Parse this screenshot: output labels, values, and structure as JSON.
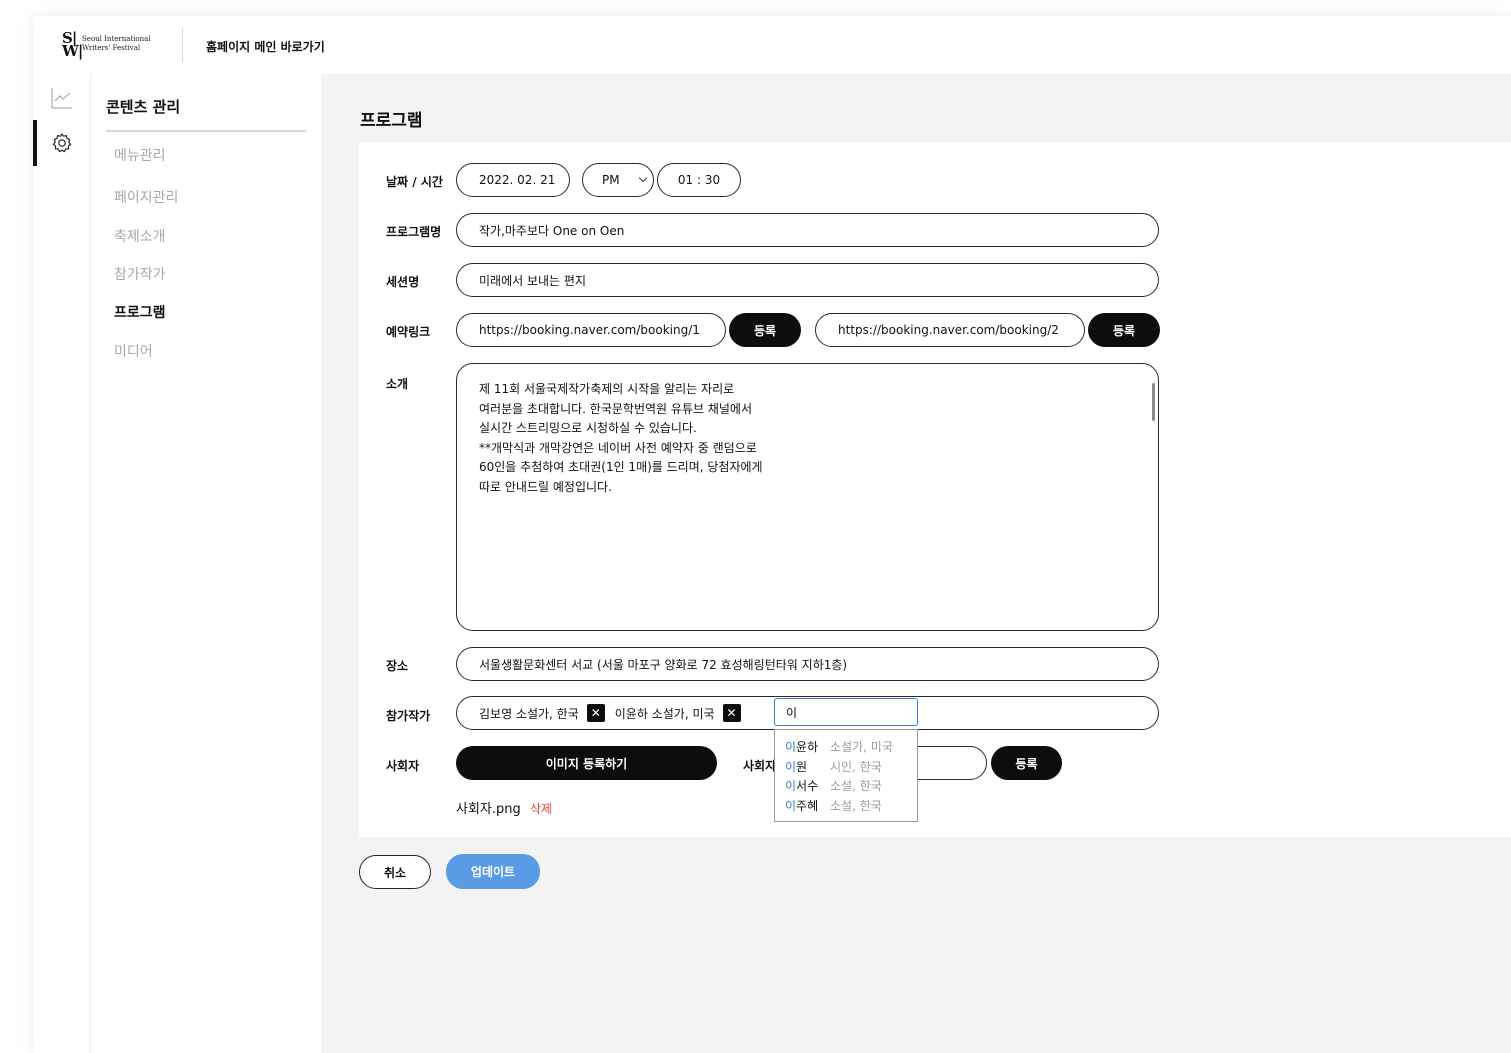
{
  "header": {
    "logo_mark": "SI\nWF",
    "logo_text": "Seoul International\nWriters' Festival",
    "home_link": "홈페이지 메인 바로가기"
  },
  "rail": {
    "icons": [
      "chart-icon",
      "gear-icon"
    ]
  },
  "sidebar": {
    "title": "콘텐츠 관리",
    "items": [
      {
        "label": "메뉴관리"
      },
      {
        "label": "페이지관리"
      },
      {
        "label": "축제소개"
      },
      {
        "label": "참가작가"
      },
      {
        "label": "프로그램"
      },
      {
        "label": "미디어"
      }
    ],
    "active": "프로그램"
  },
  "page": {
    "title": "프로그램"
  },
  "form": {
    "datetime": {
      "label": "날짜 / 시간",
      "date": "2022. 02. 21",
      "ampm": "PM",
      "time": "01 : 30"
    },
    "program_name": {
      "label": "프로그램명",
      "value": "작가,마주보다 One on Oen"
    },
    "session_name": {
      "label": "세션명",
      "value": "미래에서 보내는 편지"
    },
    "booking": {
      "label": "예약링크",
      "link1": "https://booking.naver.com/booking/1",
      "link2": "https://booking.naver.com/booking/2",
      "register_label": "등록"
    },
    "intro": {
      "label": "소개",
      "lines": [
        "제 11회 서울국제작가축제의 시작을 알리는 자리로",
        "여러분을 초대합니다. 한국문학번역원 유튜브 채널에서",
        "실시간 스트리밍으로 시청하실 수 있습니다.",
        "**개막식과 개막강연은 네이버 사전 예약자 중 랜덤으로",
        "60인을 추첨하여 초대권(1인 1매)를 드리며, 당첨자에게",
        "따로 안내드릴 예정입니다."
      ]
    },
    "venue": {
      "label": "장소",
      "value": "서울생활문화센터 서교 (서울 마포구 양화로 72 효성해링턴타워 지하1층)"
    },
    "authors": {
      "label": "참가작가",
      "tags": [
        "김보영 소설가, 한국",
        "이윤하 소설가, 미국"
      ],
      "input_value": "이",
      "suggestions": [
        {
          "name": "이윤하",
          "desc": "소설가, 미국"
        },
        {
          "name": "이원",
          "desc": "시인, 한국"
        },
        {
          "name": "이서수",
          "desc": "소설, 한국"
        },
        {
          "name": "이주혜",
          "desc": "소설, 한국"
        }
      ]
    },
    "host": {
      "label": "사회자",
      "image_button": "이미지 등록하기",
      "label2": "사회자",
      "register_label": "등록",
      "file_name": "사회자.png",
      "delete_label": "삭제"
    }
  },
  "actions": {
    "cancel": "취소",
    "update": "업데이트"
  },
  "colors": {
    "accent": "#3b7bd6",
    "update_button": "#5a9be6",
    "delete": "#e0463a",
    "button_dark": "#0d0d0d"
  }
}
